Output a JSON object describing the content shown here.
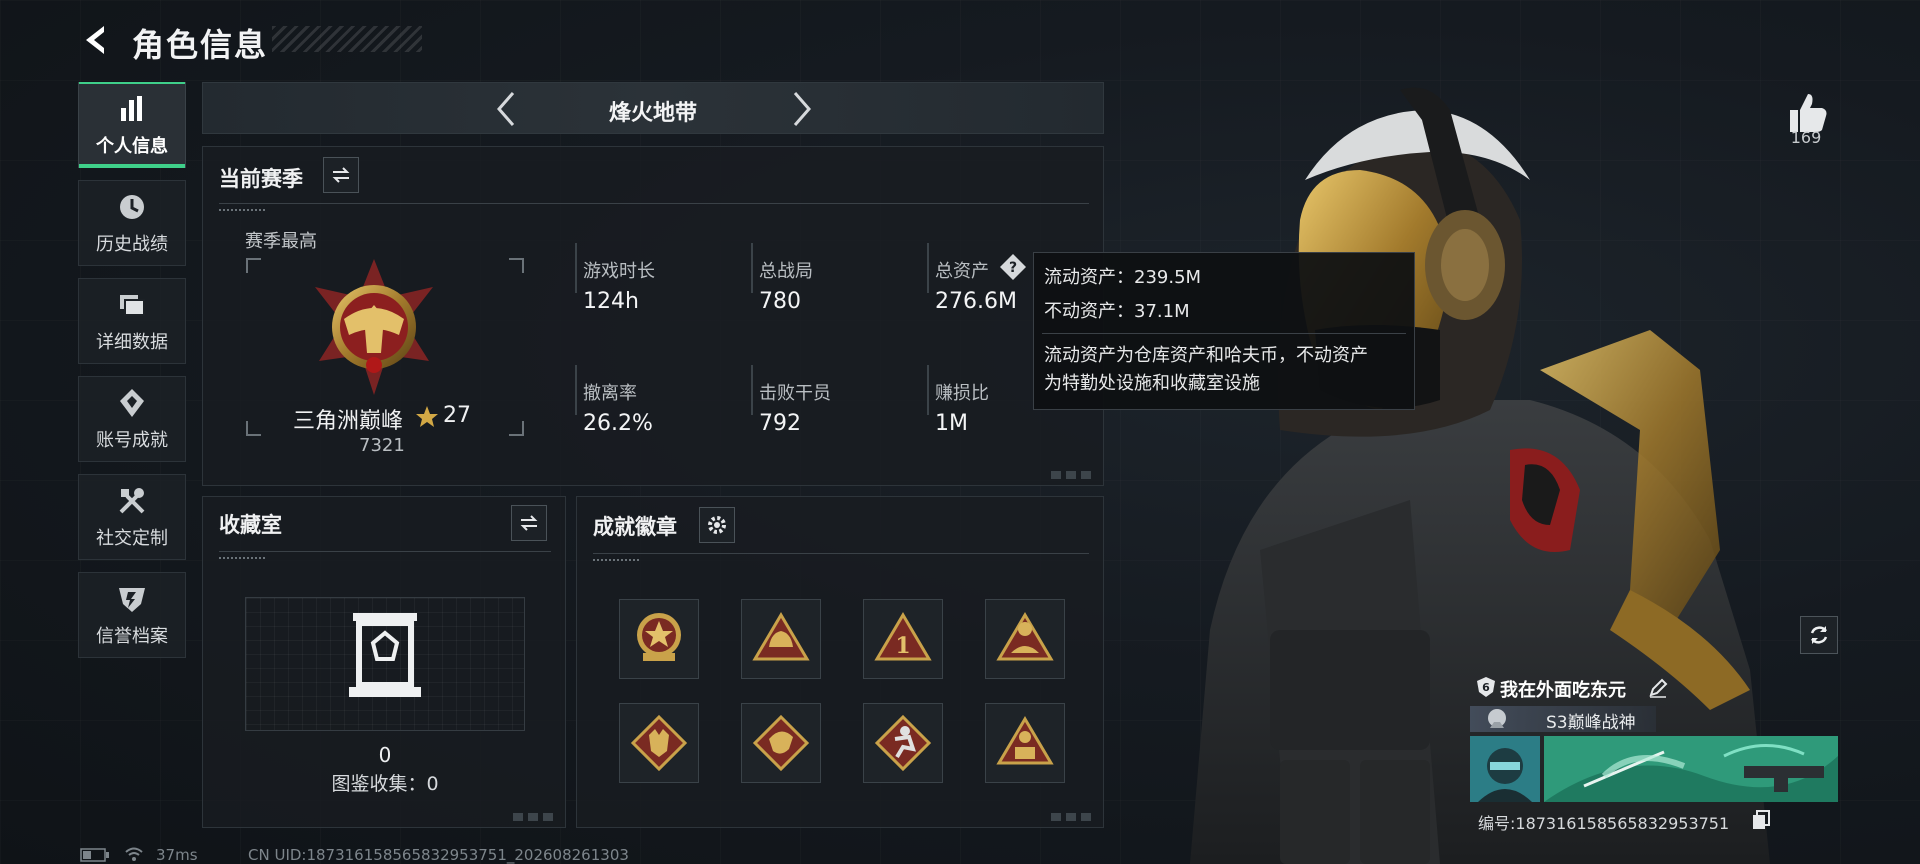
{
  "header": {
    "title": "角色信息"
  },
  "sidebar": {
    "items": [
      {
        "label": "个人信息",
        "icon": "bar-chart-icon",
        "active": true
      },
      {
        "label": "历史战绩",
        "icon": "history-icon",
        "active": false
      },
      {
        "label": "详细数据",
        "icon": "folders-icon",
        "active": false
      },
      {
        "label": "账号成就",
        "icon": "achievement-icon",
        "active": false
      },
      {
        "label": "社交定制",
        "icon": "tools-icon",
        "active": false
      },
      {
        "label": "信誉档案",
        "icon": "credit-shield-icon",
        "active": false
      }
    ]
  },
  "mode": {
    "label": "烽火地带"
  },
  "season": {
    "heading": "当前赛季",
    "best_label": "赛季最高",
    "rank_name": "三角洲巅峰",
    "rank_stars": "27",
    "rank_points": "7321",
    "stats": [
      {
        "label": "游戏时长",
        "value": "124h"
      },
      {
        "label": "总战局",
        "value": "780"
      },
      {
        "label": "总资产",
        "value": "276.6M"
      },
      {
        "label": "撤离率",
        "value": "26.2%"
      },
      {
        "label": "击败干员",
        "value": "792"
      },
      {
        "label": "赚损比",
        "value": "1M"
      }
    ]
  },
  "tooltip": {
    "liquid": "流动资产：239.5M",
    "fixed": "不动资产：37.1M",
    "desc_line1": "流动资产为仓库资产和哈夫币，不动资产",
    "desc_line2": "为特勤处设施和收藏室设施"
  },
  "collection": {
    "heading": "收藏室",
    "count": "0",
    "catalog": "图鉴收集：0"
  },
  "badges": {
    "heading": "成就徽章",
    "items": [
      "star-shield-badge",
      "helmet-badge",
      "rank-one-badge",
      "s4-badge",
      "wolf-badge",
      "dragon-badge",
      "runner-badge",
      "s6-badge"
    ]
  },
  "profile": {
    "likes": "169",
    "player_name": "我在外面吃东元",
    "title": "S3巅峰战神",
    "serial": "编号:18731615856583295375​1"
  },
  "status_bar": {
    "ping": "37ms",
    "uid": "CN UID:1873161585658329537​51_202608261303"
  },
  "colors": {
    "accent": "#3fd08a",
    "gold": "#c9a24a",
    "badge_red": "#7a2a22"
  }
}
